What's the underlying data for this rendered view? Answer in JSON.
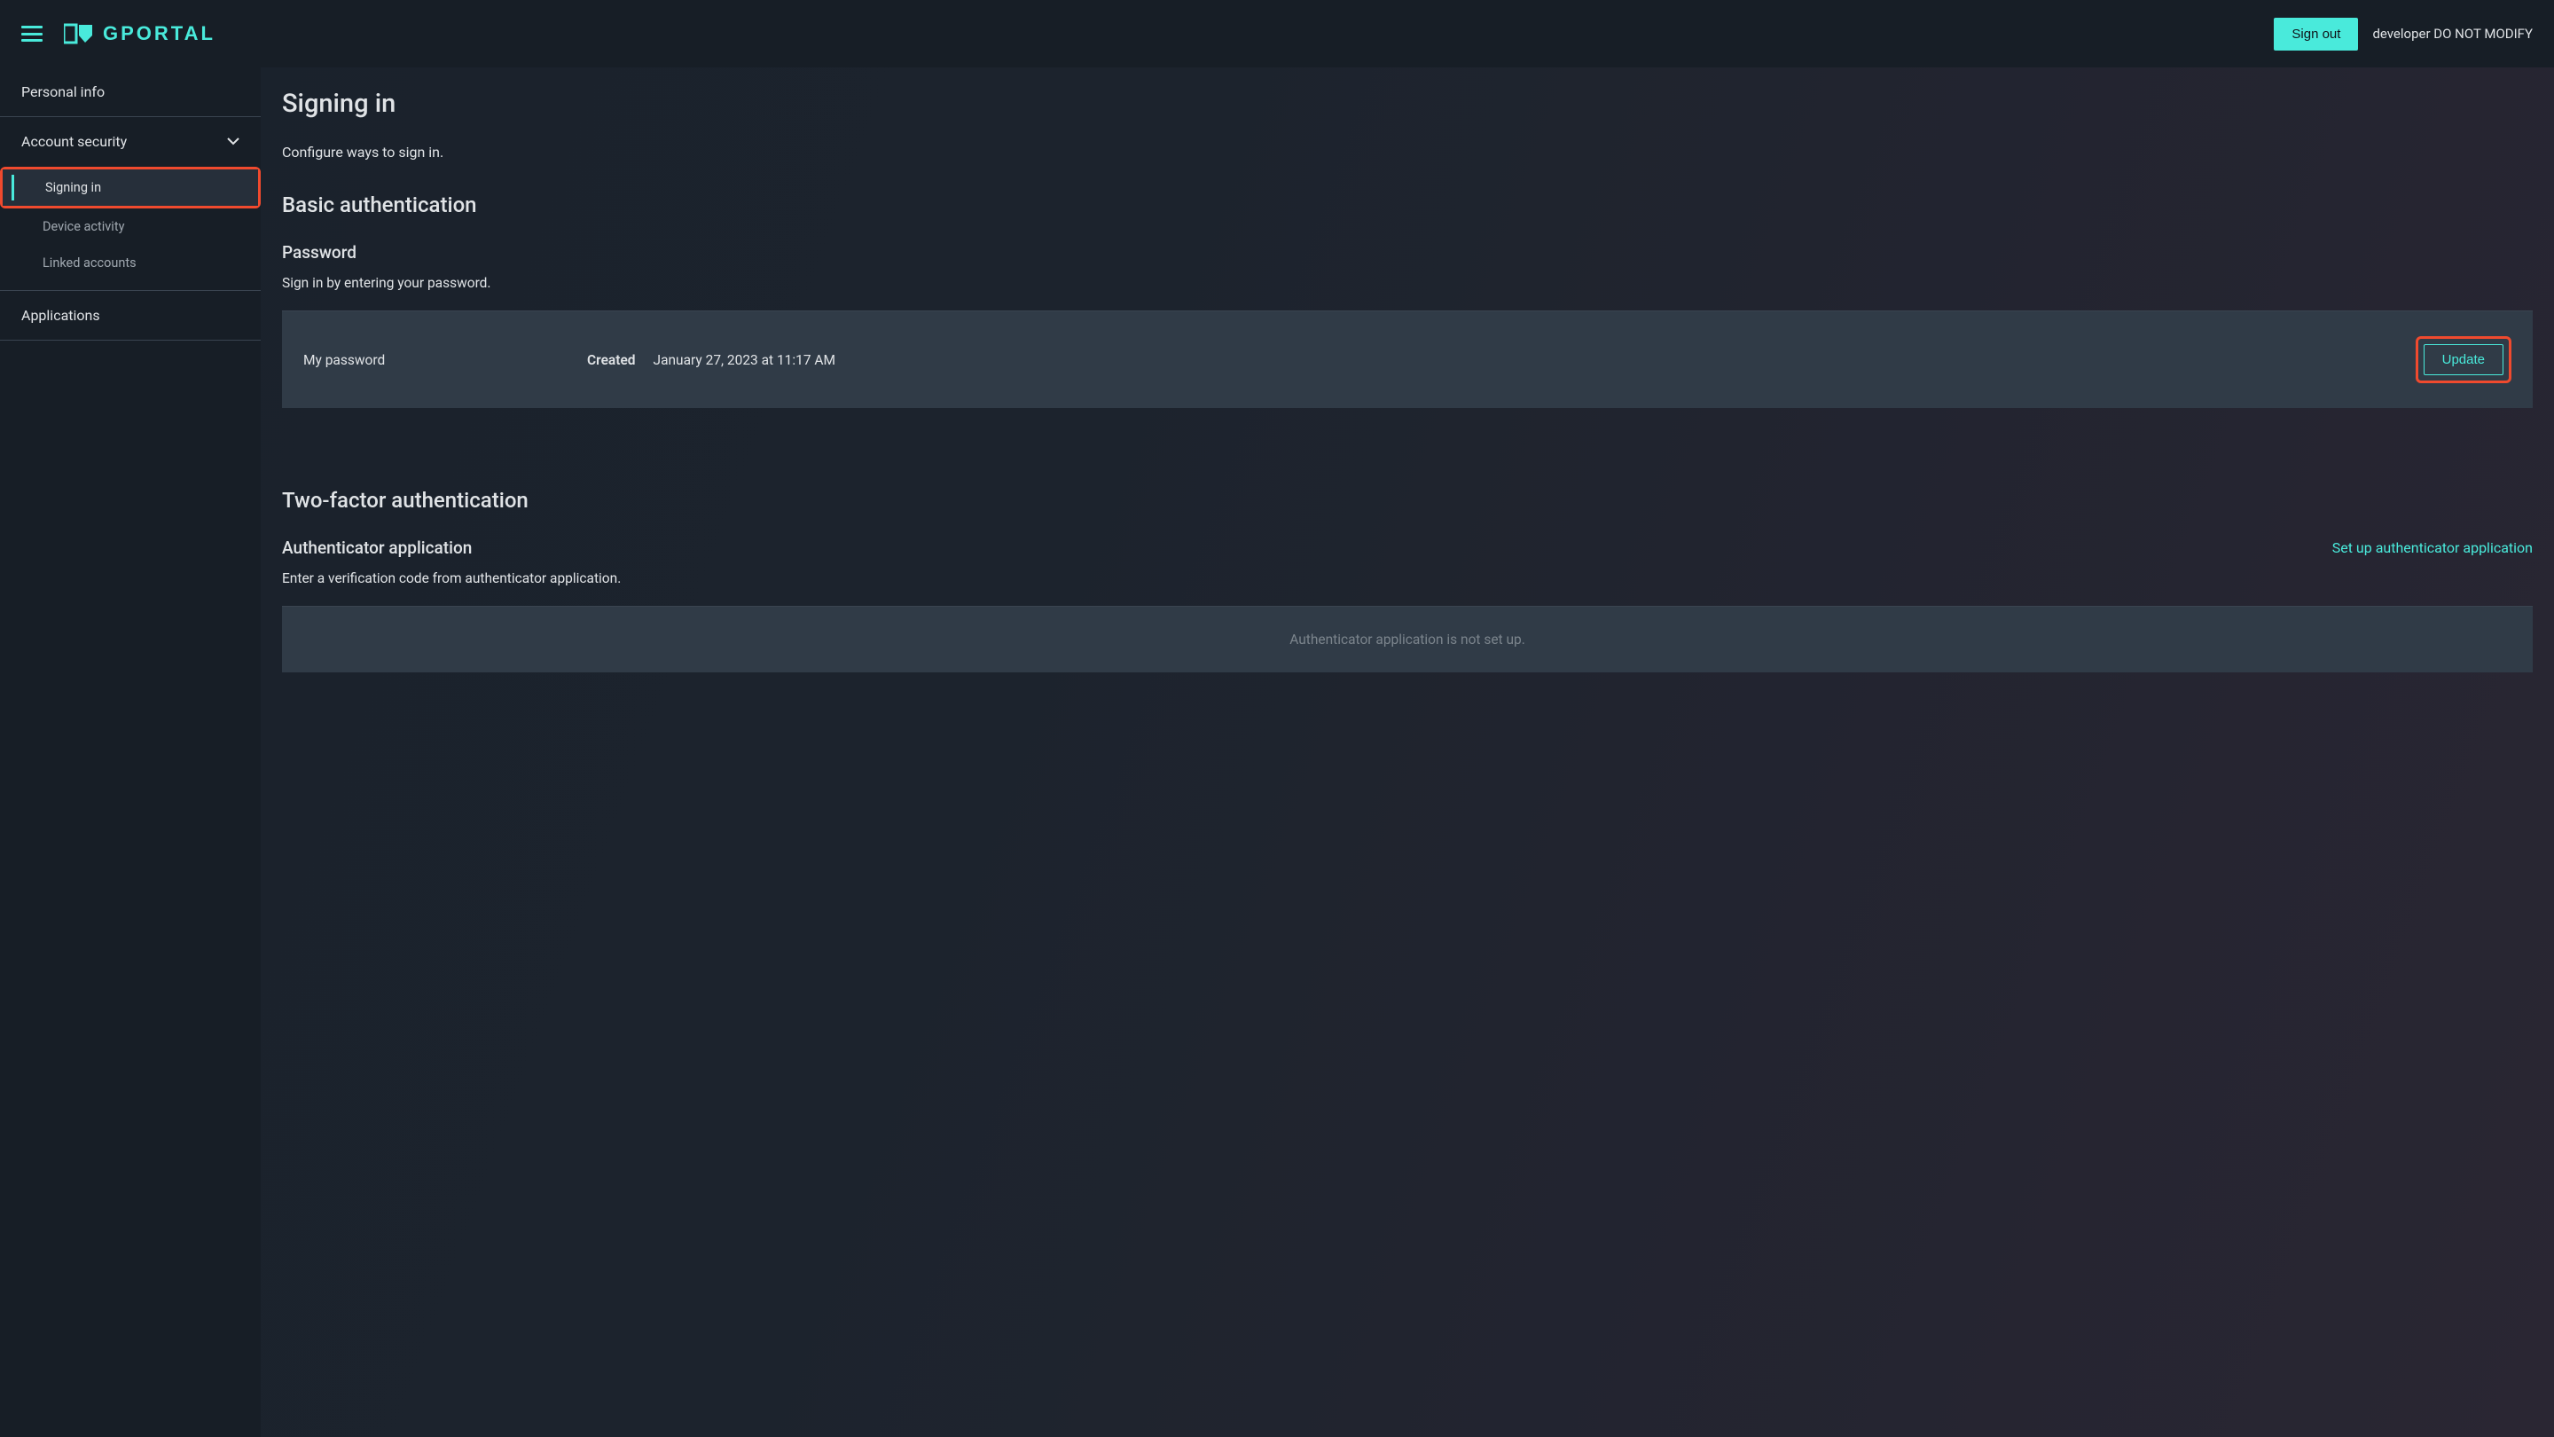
{
  "header": {
    "logo_text": "GPORTAL",
    "signout_label": "Sign out",
    "note": "developer DO NOT MODIFY"
  },
  "sidebar": {
    "personal_info": "Personal info",
    "account_security": "Account security",
    "sub": {
      "signing_in": "Signing in",
      "device_activity": "Device activity",
      "linked_accounts": "Linked accounts"
    },
    "applications": "Applications"
  },
  "main": {
    "page_title": "Signing in",
    "page_subtitle": "Configure ways to sign in.",
    "basic_auth_heading": "Basic authentication",
    "password": {
      "title": "Password",
      "desc": "Sign in by entering your password.",
      "label": "My password",
      "created_label": "Created",
      "created_value": "January 27, 2023 at 11:17 AM",
      "update_label": "Update"
    },
    "two_factor": {
      "heading": "Two-factor authentication",
      "app_title": "Authenticator application",
      "app_desc": "Enter a verification code from authenticator application.",
      "setup_link": "Set up authenticator application",
      "empty_msg": "Authenticator application is not set up."
    }
  }
}
